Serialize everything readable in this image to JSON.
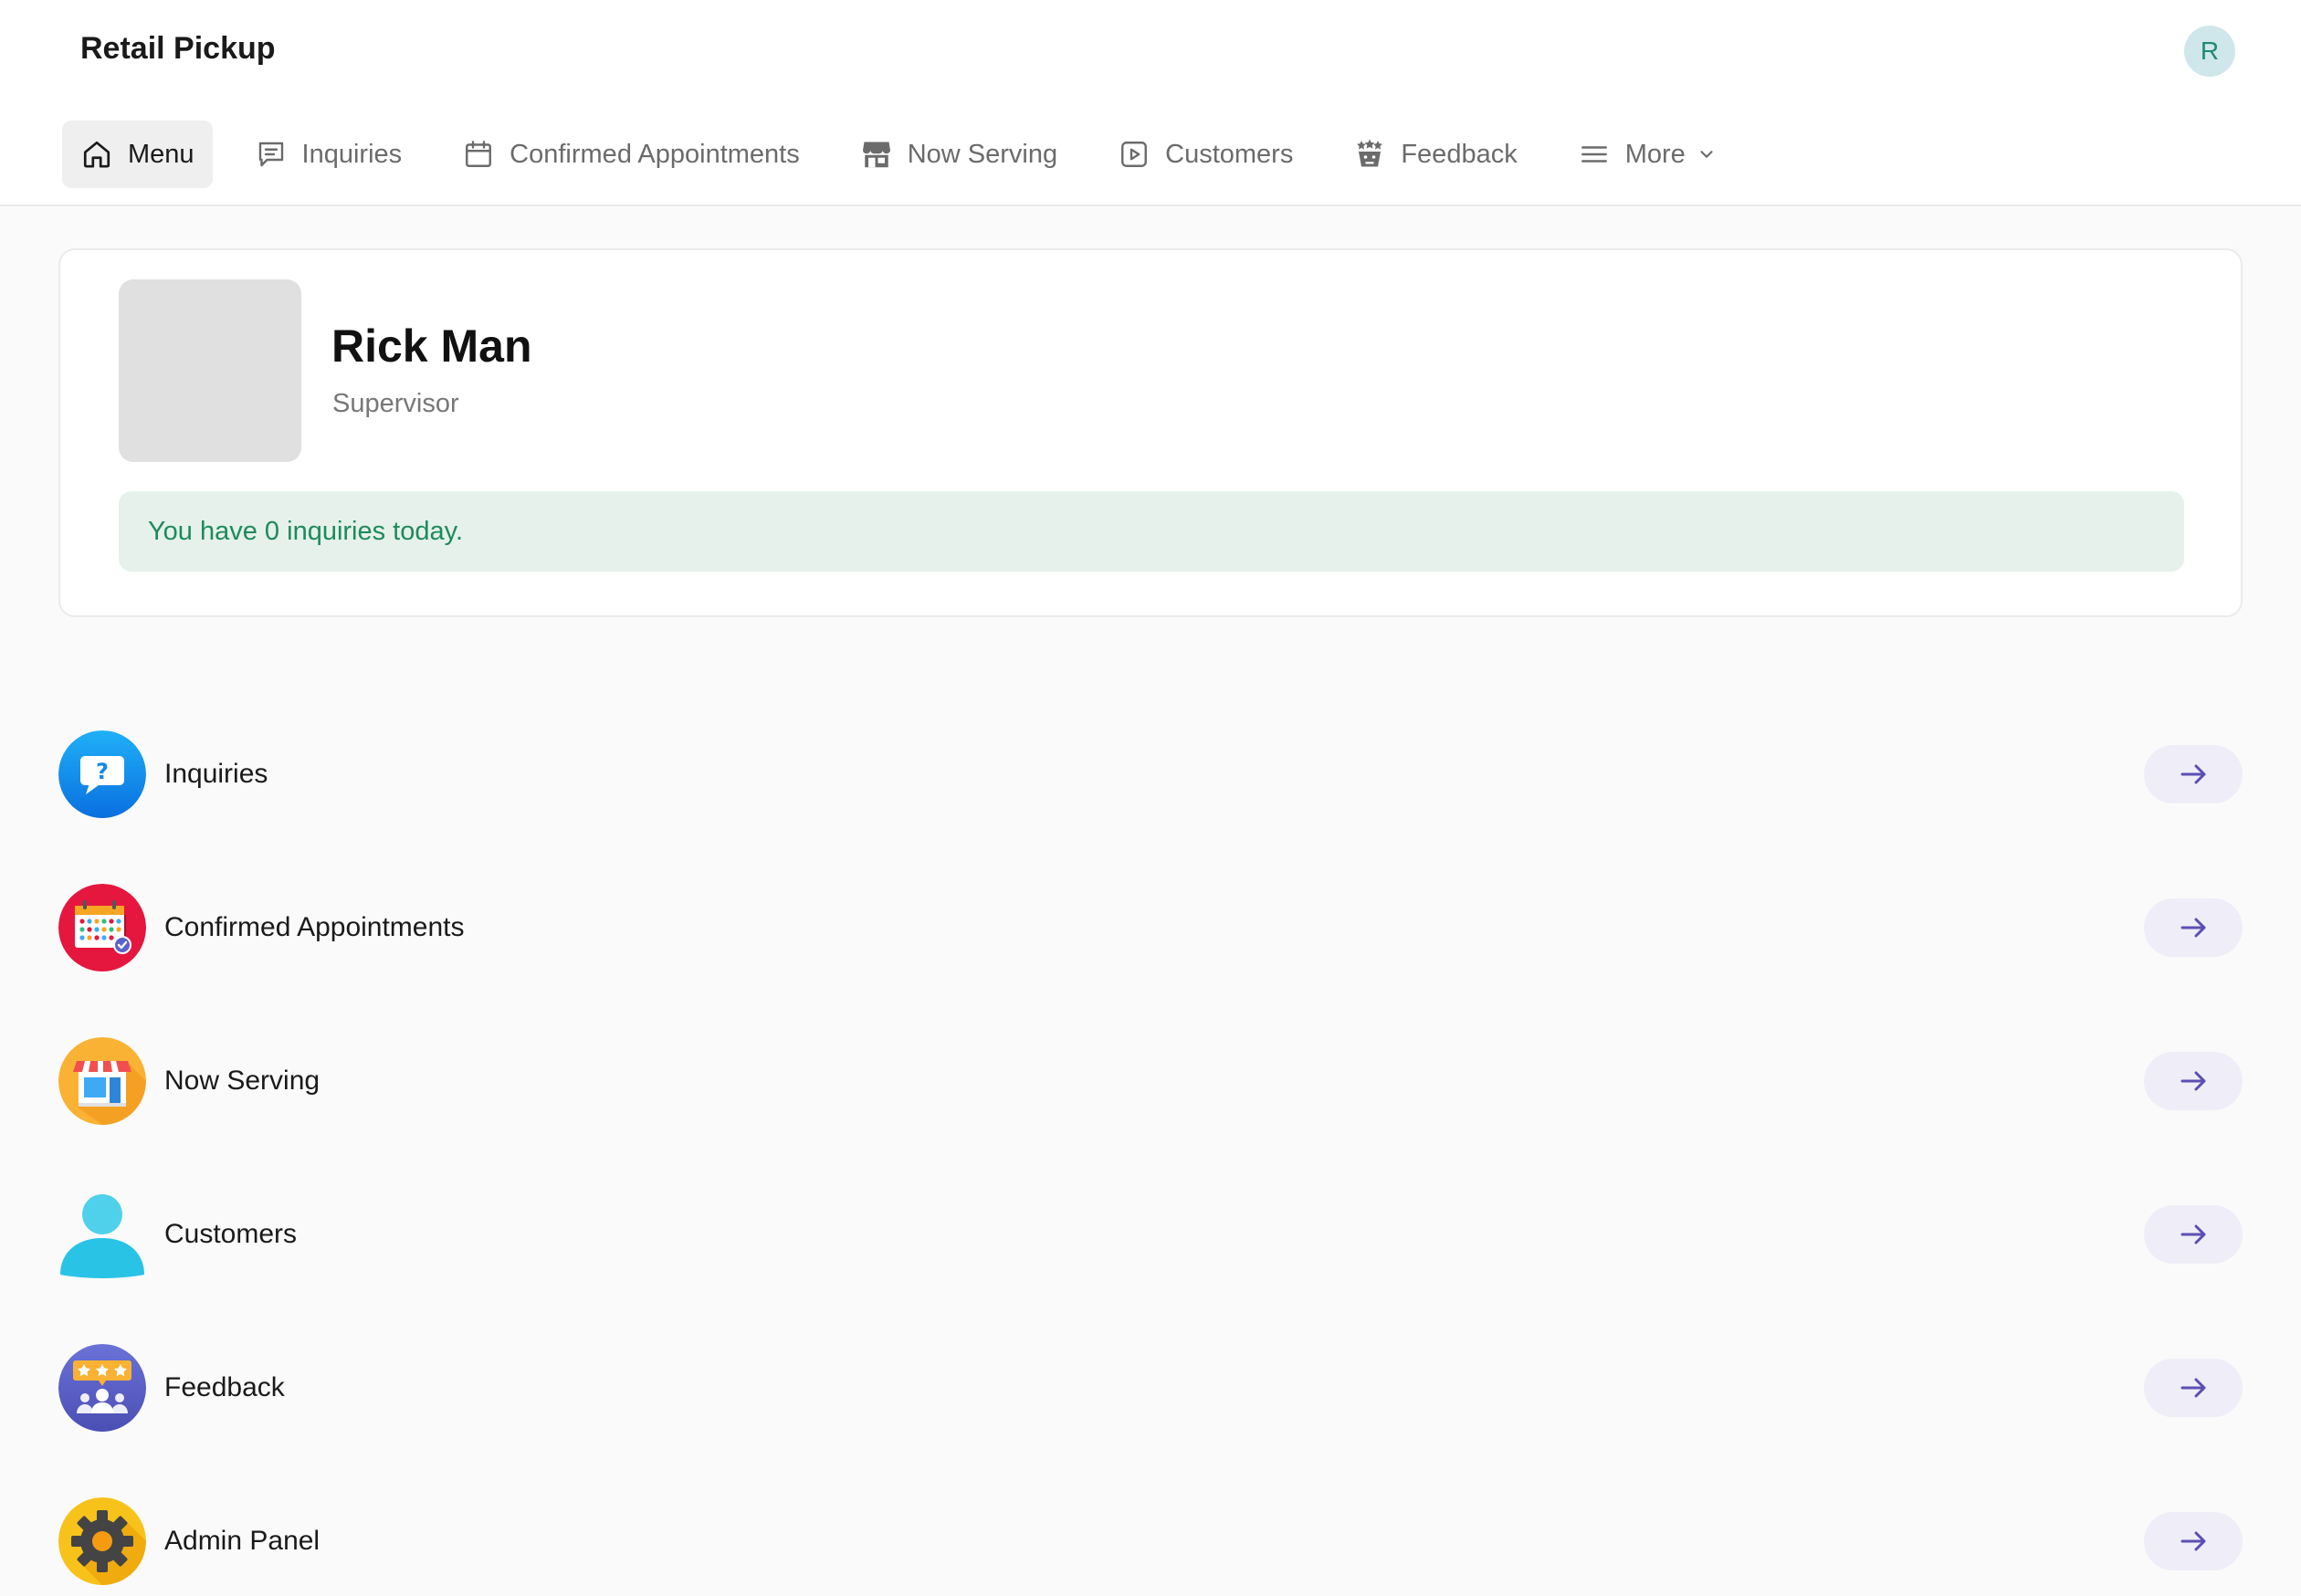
{
  "header": {
    "app_title": "Retail Pickup",
    "avatar_initial": "R"
  },
  "nav": {
    "items": [
      {
        "label": "Menu",
        "icon": "home-icon",
        "active": true
      },
      {
        "label": "Inquiries",
        "icon": "chat-icon"
      },
      {
        "label": "Confirmed Appointments",
        "icon": "calendar-icon"
      },
      {
        "label": "Now Serving",
        "icon": "store-icon"
      },
      {
        "label": "Customers",
        "icon": "play-square-icon"
      },
      {
        "label": "Feedback",
        "icon": "stars-basket-icon"
      },
      {
        "label": "More",
        "icon": "hamburger-icon"
      }
    ]
  },
  "profile": {
    "name": "Rick Man",
    "role": "Supervisor",
    "notice": "You have 0 inquiries today."
  },
  "menu": {
    "items": [
      {
        "label": "Inquiries",
        "icon": "question-bubble-icon",
        "color": "#1aa3f5"
      },
      {
        "label": "Confirmed Appointments",
        "icon": "calendar-check-icon",
        "color": "#e5173f"
      },
      {
        "label": "Now Serving",
        "icon": "storefront-icon",
        "color": "#f9b233"
      },
      {
        "label": "Customers",
        "icon": "user-icon",
        "color": "#3ecbe8"
      },
      {
        "label": "Feedback",
        "icon": "rating-group-icon",
        "color": "#5b62c9"
      },
      {
        "label": "Admin Panel",
        "icon": "gear-icon",
        "color": "#f7c21a"
      }
    ]
  },
  "colors": {
    "accent": "#5b4fb3",
    "notice_bg": "#e5f1ea",
    "notice_text": "#1e8a5c"
  }
}
